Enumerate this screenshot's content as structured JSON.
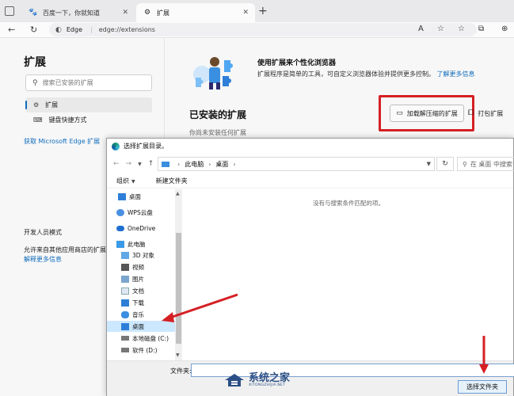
{
  "browser": {
    "tabs": [
      {
        "title": "百度一下，你就知道",
        "icon": "paw-icon",
        "active": false
      },
      {
        "title": "扩展",
        "icon": "extensions-icon",
        "active": true
      }
    ],
    "new_tab": "+",
    "address_prefix": "Edge",
    "address_url": "edge://extensions"
  },
  "sidebar": {
    "title": "扩展",
    "search_placeholder": "搜索已安装的扩展",
    "items": [
      {
        "label": "扩展",
        "icon": "extensions-icon",
        "active": true
      },
      {
        "label": "键盘快捷方式",
        "icon": "keyboard-icon",
        "active": false
      }
    ],
    "get_link": "获取 Microsoft Edge 扩展",
    "dev_mode_label": "开发人员模式",
    "allow_text": "允许来自其他应用商店的扩展。",
    "learn_more": "解释更多信息"
  },
  "main": {
    "promo_title": "使用扩展来个性化浏览器",
    "promo_desc": "扩展程序是简单的工具，可自定义浏览器体验并提供更多控制。",
    "promo_link": "了解更多信息",
    "installed_title": "已安装的扩展",
    "load_unpacked": "加载解压缩的扩展",
    "pack_ext": "打包扩展",
    "no_ext": "你尚未安装任何扩展"
  },
  "dialog": {
    "title": "选择扩展目录。",
    "path": [
      "此电脑",
      "桌面"
    ],
    "search_placeholder": "在 桌面 中搜索",
    "organize": "组织",
    "new_folder": "新建文件夹",
    "nav_items": [
      {
        "label": "桌面",
        "icon": "desktop-icon",
        "selected": false
      },
      {
        "label": "WPS云盘",
        "icon": "cloud-icon",
        "selected": false
      },
      {
        "label": "OneDrive",
        "icon": "onedrive-icon",
        "selected": false
      },
      {
        "label": "此电脑",
        "icon": "computer-icon",
        "selected": false
      },
      {
        "label": "3D 对象",
        "icon": "cube-icon",
        "selected": false
      },
      {
        "label": "视频",
        "icon": "video-icon",
        "selected": false
      },
      {
        "label": "图片",
        "icon": "image-icon",
        "selected": false
      },
      {
        "label": "文档",
        "icon": "document-icon",
        "selected": false
      },
      {
        "label": "下载",
        "icon": "download-icon",
        "selected": false
      },
      {
        "label": "音乐",
        "icon": "music-icon",
        "selected": false
      },
      {
        "label": "桌面",
        "icon": "desktop-icon",
        "selected": true
      },
      {
        "label": "本地磁盘 (C:)",
        "icon": "drive-icon",
        "selected": false
      },
      {
        "label": "软件 (D:)",
        "icon": "drive-icon",
        "selected": false
      }
    ],
    "empty_message": "没有与搜索条件匹配的项。",
    "filename_label": "文件夹:",
    "select_button": "选择文件夹"
  },
  "watermark": {
    "main": "系统之家",
    "sub": "XITONGZHIJIA.NET"
  },
  "colors": {
    "accent": "#0f6cbd",
    "highlight_red": "#d51f24",
    "selection": "#cce8ff"
  }
}
